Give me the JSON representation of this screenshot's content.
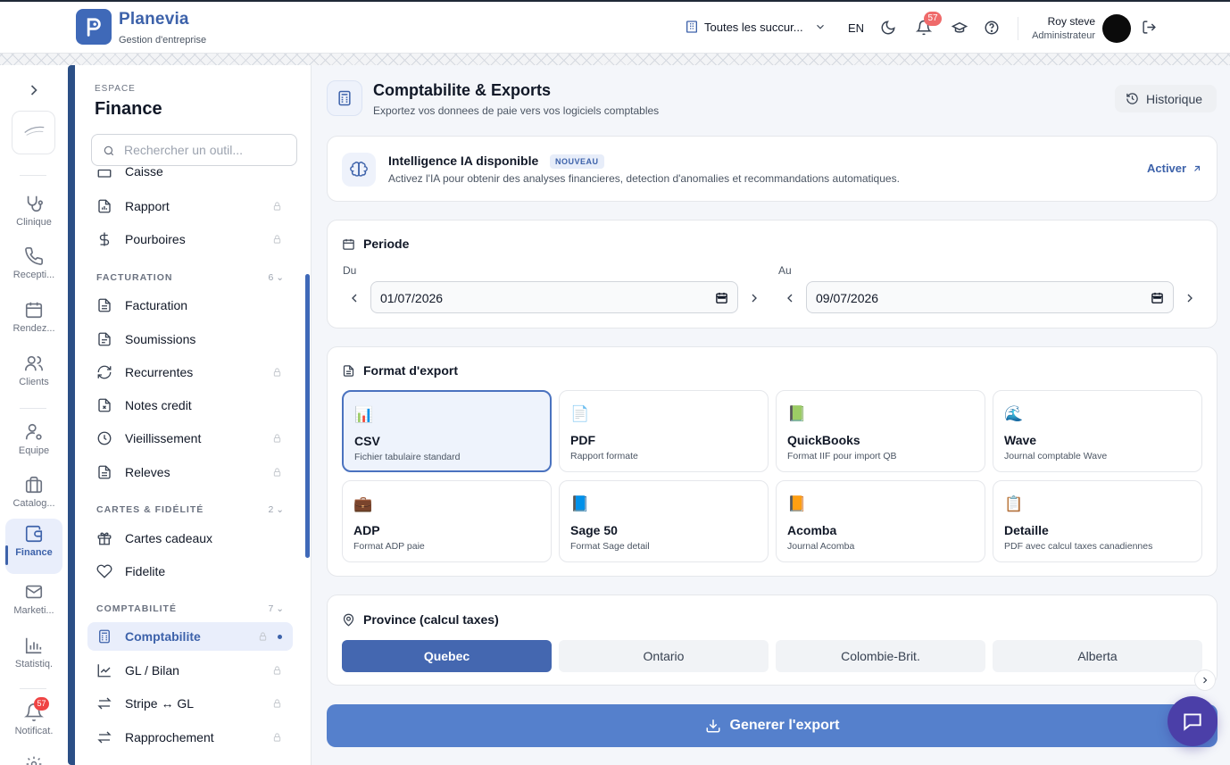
{
  "header": {
    "brand": "Planevia",
    "brand_sub": "Gestion d'entreprise",
    "branch": "Toutes les succur...",
    "lang": "EN",
    "notif_count": "57",
    "user_name": "Roy steve",
    "user_role": "Administrateur"
  },
  "rail": {
    "items": [
      {
        "label": "Clinique",
        "icon": "stethoscope-icon"
      },
      {
        "label": "Recepti...",
        "icon": "phone-icon"
      },
      {
        "label": "Rendez...",
        "icon": "calendar-icon"
      },
      {
        "label": "Clients",
        "icon": "users-icon"
      },
      {
        "label": "Equipe",
        "icon": "user-gear-icon"
      },
      {
        "label": "Catalog...",
        "icon": "briefcase-icon"
      },
      {
        "label": "Finance",
        "icon": "wallet-icon"
      },
      {
        "label": "Marketi...",
        "icon": "mail-icon"
      },
      {
        "label": "Statistiq.",
        "icon": "chart-icon"
      },
      {
        "label": "Notificat.",
        "icon": "bell-icon"
      }
    ],
    "notif_badge": "57"
  },
  "sidebar": {
    "eyebrow": "ESPACE",
    "title": "Finance",
    "search_placeholder": "Rechercher un outil...",
    "cut_item": "Caisse",
    "group1": [
      "Rapport",
      "Pourboires"
    ],
    "sections": [
      {
        "label": "FACTURATION",
        "count": "6"
      },
      {
        "label": "CARTES & FIDÉLITÉ",
        "count": "2"
      },
      {
        "label": "COMPTABILITÉ",
        "count": "7"
      }
    ],
    "facturation": [
      "Facturation",
      "Soumissions",
      "Recurrentes",
      "Notes credit",
      "Vieillissement",
      "Releves"
    ],
    "cartes": [
      "Cartes cadeaux",
      "Fidelite"
    ],
    "comptabilite": [
      "Comptabilite",
      "GL / Bilan",
      "Stripe ↔ GL",
      "Rapprochement"
    ]
  },
  "main": {
    "title": "Comptabilite & Exports",
    "subtitle": "Exportez vos donnees de paie vers vos logiciels comptables",
    "history_label": "Historique",
    "ai": {
      "title": "Intelligence IA disponible",
      "badge": "NOUVEAU",
      "desc": "Activez l'IA pour obtenir des analyses financieres, detection d'anomalies et recommandations automatiques.",
      "action": "Activer"
    },
    "period": {
      "title": "Periode",
      "from_label": "Du",
      "to_label": "Au",
      "from_value": "01/07/2026",
      "to_value": "09/07/2026"
    },
    "format": {
      "title": "Format d'export",
      "options": [
        {
          "emoji": "📊",
          "name": "CSV",
          "desc": "Fichier tabulaire standard"
        },
        {
          "emoji": "📄",
          "name": "PDF",
          "desc": "Rapport formate"
        },
        {
          "emoji": "📗",
          "name": "QuickBooks",
          "desc": "Format IIF pour import QB"
        },
        {
          "emoji": "🌊",
          "name": "Wave",
          "desc": "Journal comptable Wave"
        },
        {
          "emoji": "💼",
          "name": "ADP",
          "desc": "Format ADP paie"
        },
        {
          "emoji": "📘",
          "name": "Sage 50",
          "desc": "Format Sage detail"
        },
        {
          "emoji": "📙",
          "name": "Acomba",
          "desc": "Journal Acomba"
        },
        {
          "emoji": "📋",
          "name": "Detaille",
          "desc": "PDF avec calcul taxes canadiennes"
        }
      ]
    },
    "province": {
      "title": "Province (calcul taxes)",
      "options": [
        "Quebec",
        "Ontario",
        "Colombie-Brit.",
        "Alberta"
      ]
    },
    "generate_label": "Generer l'export"
  }
}
